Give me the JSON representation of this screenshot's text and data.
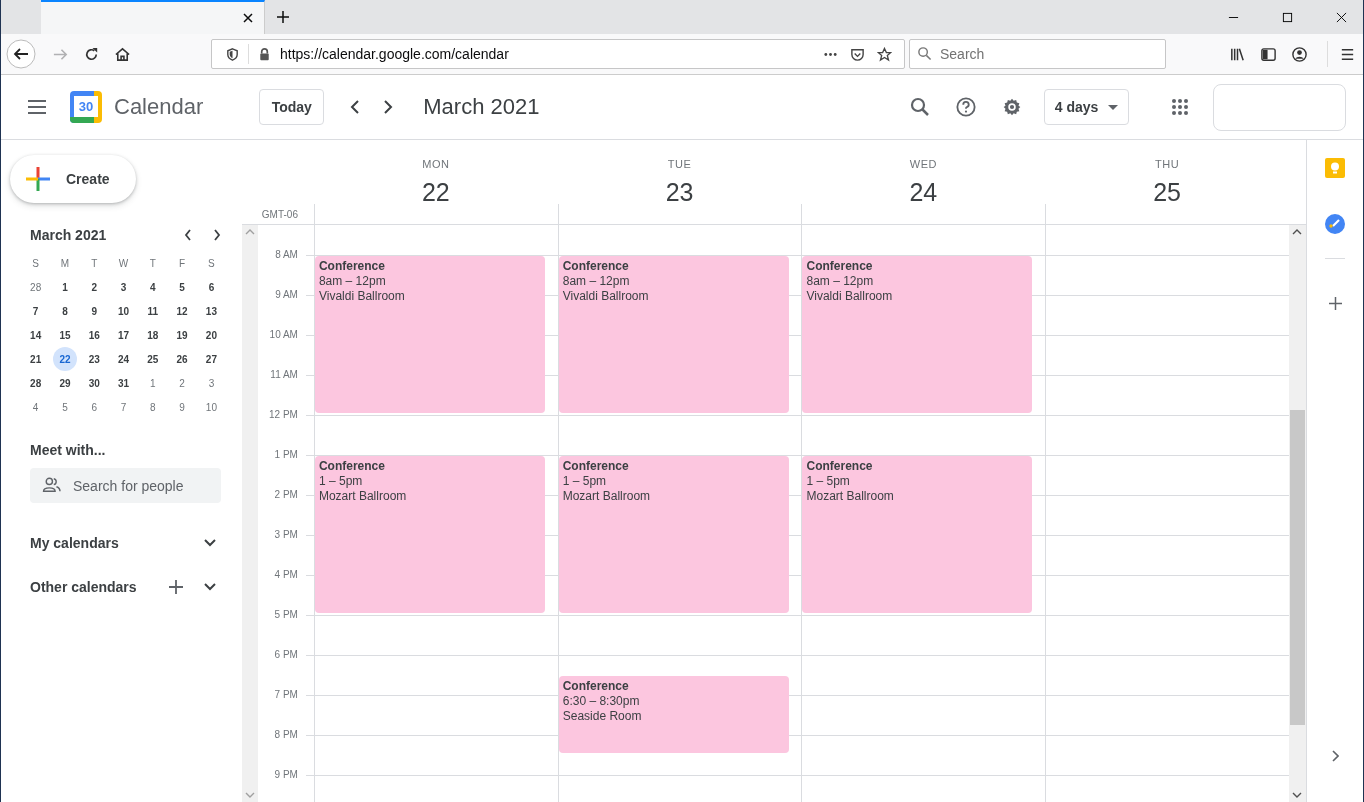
{
  "browser": {
    "url": "https://calendar.google.com/calendar",
    "search_placeholder": "Search",
    "forward_disabled": true
  },
  "app": {
    "logo_day": "30",
    "name": "Calendar",
    "today_button": "Today",
    "period": "March 2021",
    "view_select": "4 days"
  },
  "sidebar": {
    "create": "Create",
    "mini_calendar": {
      "title": "March 2021",
      "weekdays": [
        "S",
        "M",
        "T",
        "W",
        "T",
        "F",
        "S"
      ],
      "weeks": [
        [
          {
            "label": "28",
            "muted": true,
            "selected": false
          },
          {
            "label": "1",
            "muted": false,
            "selected": false
          },
          {
            "label": "2",
            "muted": false,
            "selected": false
          },
          {
            "label": "3",
            "muted": false,
            "selected": false
          },
          {
            "label": "4",
            "muted": false,
            "selected": false
          },
          {
            "label": "5",
            "muted": false,
            "selected": false
          },
          {
            "label": "6",
            "muted": false,
            "selected": false
          }
        ],
        [
          {
            "label": "7",
            "muted": false,
            "selected": false
          },
          {
            "label": "8",
            "muted": false,
            "selected": false
          },
          {
            "label": "9",
            "muted": false,
            "selected": false
          },
          {
            "label": "10",
            "muted": false,
            "selected": false
          },
          {
            "label": "11",
            "muted": false,
            "selected": false
          },
          {
            "label": "12",
            "muted": false,
            "selected": false
          },
          {
            "label": "13",
            "muted": false,
            "selected": false
          }
        ],
        [
          {
            "label": "14",
            "muted": false,
            "selected": false
          },
          {
            "label": "15",
            "muted": false,
            "selected": false
          },
          {
            "label": "16",
            "muted": false,
            "selected": false
          },
          {
            "label": "17",
            "muted": false,
            "selected": false
          },
          {
            "label": "18",
            "muted": false,
            "selected": false
          },
          {
            "label": "19",
            "muted": false,
            "selected": false
          },
          {
            "label": "20",
            "muted": false,
            "selected": false
          }
        ],
        [
          {
            "label": "21",
            "muted": false,
            "selected": false
          },
          {
            "label": "22",
            "muted": false,
            "selected": true
          },
          {
            "label": "23",
            "muted": false,
            "selected": false
          },
          {
            "label": "24",
            "muted": false,
            "selected": false
          },
          {
            "label": "25",
            "muted": false,
            "selected": false
          },
          {
            "label": "26",
            "muted": false,
            "selected": false
          },
          {
            "label": "27",
            "muted": false,
            "selected": false
          }
        ],
        [
          {
            "label": "28",
            "muted": false,
            "selected": false
          },
          {
            "label": "29",
            "muted": false,
            "selected": false
          },
          {
            "label": "30",
            "muted": false,
            "selected": false
          },
          {
            "label": "31",
            "muted": false,
            "selected": false
          },
          {
            "label": "1",
            "muted": true,
            "selected": false
          },
          {
            "label": "2",
            "muted": true,
            "selected": false
          },
          {
            "label": "3",
            "muted": true,
            "selected": false
          }
        ],
        [
          {
            "label": "4",
            "muted": true,
            "selected": false
          },
          {
            "label": "5",
            "muted": true,
            "selected": false
          },
          {
            "label": "6",
            "muted": true,
            "selected": false
          },
          {
            "label": "7",
            "muted": true,
            "selected": false
          },
          {
            "label": "8",
            "muted": true,
            "selected": false
          },
          {
            "label": "9",
            "muted": true,
            "selected": false
          },
          {
            "label": "10",
            "muted": true,
            "selected": false
          }
        ]
      ]
    },
    "meet_with": {
      "title": "Meet with...",
      "placeholder": "Search for people"
    },
    "sections": [
      {
        "label": "My calendars",
        "can_add": false
      },
      {
        "label": "Other calendars",
        "can_add": true
      }
    ]
  },
  "grid": {
    "timezone": "GMT-06",
    "hours": [
      "8 AM",
      "9 AM",
      "10 AM",
      "11 AM",
      "12 PM",
      "1 PM",
      "2 PM",
      "3 PM",
      "4 PM",
      "5 PM",
      "6 PM",
      "7 PM",
      "8 PM",
      "9 PM"
    ],
    "days": [
      {
        "weekday": "MON",
        "date": "22",
        "events": [
          {
            "title": "Conference",
            "time": "8am – 12pm",
            "location": "Vivaldi Ballroom"
          },
          {
            "title": "Conference",
            "time": "1 – 5pm",
            "location": "Mozart Ballroom"
          }
        ]
      },
      {
        "weekday": "TUE",
        "date": "23",
        "events": [
          {
            "title": "Conference",
            "time": "8am – 12pm",
            "location": "Vivaldi Ballroom"
          },
          {
            "title": "Conference",
            "time": "1 – 5pm",
            "location": "Mozart Ballroom"
          },
          {
            "title": "Conference",
            "time": "6:30 – 8:30pm",
            "location": "Seaside Room"
          }
        ]
      },
      {
        "weekday": "WED",
        "date": "24",
        "events": [
          {
            "title": "Conference",
            "time": "8am – 12pm",
            "location": "Vivaldi Ballroom"
          },
          {
            "title": "Conference",
            "time": "1 – 5pm",
            "location": "Mozart Ballroom"
          }
        ]
      },
      {
        "weekday": "THU",
        "date": "25"
      }
    ]
  }
}
